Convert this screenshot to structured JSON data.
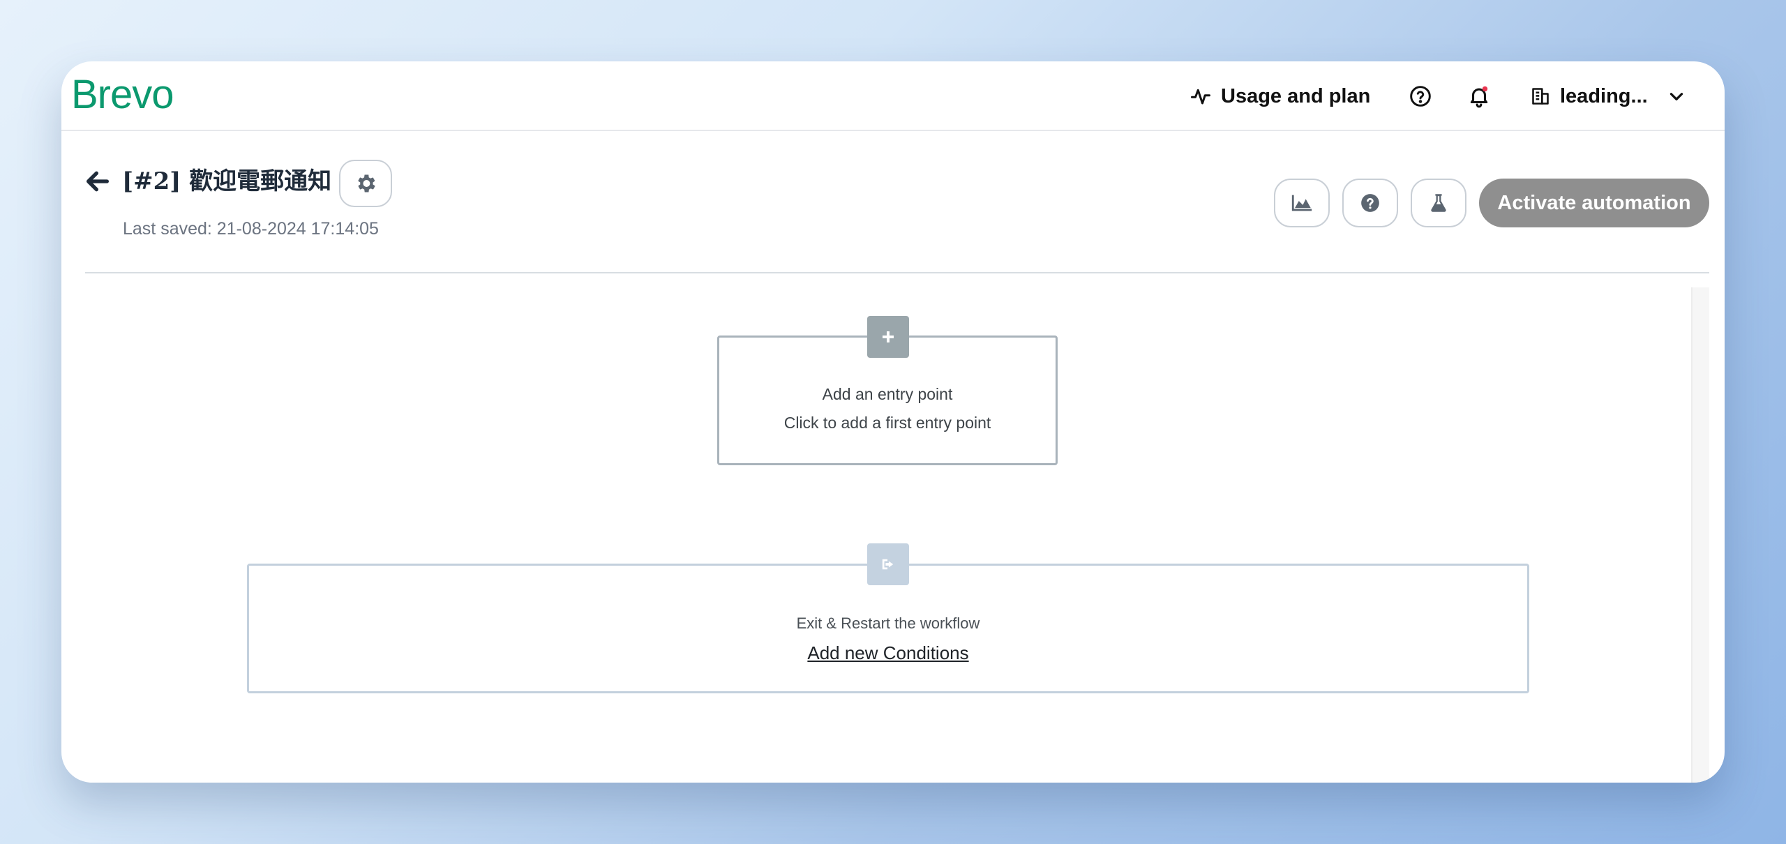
{
  "topbar": {
    "logo": "Brevo",
    "usage_label": "Usage and plan",
    "org_name": "leading..."
  },
  "header": {
    "title": "[#2] 歡迎電郵通知",
    "last_saved": "Last saved: 21-08-2024 17:14:05",
    "activate_label": "Activate automation"
  },
  "canvas": {
    "entry": {
      "title": "Add an entry point",
      "subtitle": "Click to add a first entry point"
    },
    "exit": {
      "title": "Exit & Restart the workflow",
      "link": "Add new Conditions"
    }
  },
  "icons": {
    "back": "arrow-left-icon",
    "settings": "gear-icon",
    "usage": "activity-icon",
    "help": "question-circle-icon",
    "notifications": "bell-icon",
    "org": "building-icon",
    "dropdown": "chevron-down-icon",
    "stats": "area-chart-icon",
    "test": "flask-icon",
    "add": "plus-icon",
    "exit": "sign-out-icon"
  },
  "colors": {
    "brand": "#0b996e",
    "activate_button": "#8f8f8f",
    "notification_dot": "#e8344e"
  }
}
